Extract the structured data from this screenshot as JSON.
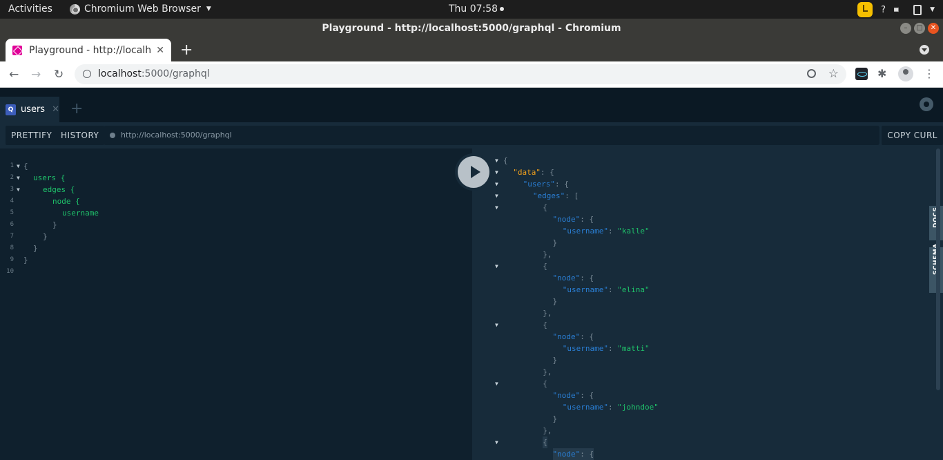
{
  "system": {
    "activities": "Activities",
    "app_name": "Chromium Web Browser",
    "clock": "Thu 07:58",
    "tray_help": "?"
  },
  "window": {
    "title": "Playground - http://localhost:5000/graphql - Chromium"
  },
  "browser": {
    "tab_title": "Playground - http://localh",
    "url_host": "localhost",
    "url_path": ":5000/graphql"
  },
  "playground": {
    "tab_icon": "Q",
    "tab_name": "users",
    "prettify": "PRETTIFY",
    "history": "HISTORY",
    "endpoint": "http://localhost:5000/graphql",
    "copy_curl": "COPY CURL",
    "docs": "DOCS",
    "schema": "SCHEMA"
  },
  "query_lines": [
    {
      "num": "1",
      "text": "{",
      "fold": true,
      "kind": "punct",
      "indent": 0
    },
    {
      "num": "2",
      "text": "users {",
      "fold": true,
      "kind": "field",
      "indent": 1
    },
    {
      "num": "3",
      "text": "edges {",
      "fold": true,
      "kind": "field",
      "indent": 2
    },
    {
      "num": "4",
      "text": "node {",
      "fold": false,
      "kind": "field",
      "indent": 3
    },
    {
      "num": "5",
      "text": "username",
      "fold": false,
      "kind": "field",
      "indent": 4
    },
    {
      "num": "6",
      "text": "}",
      "fold": false,
      "kind": "punct",
      "indent": 3
    },
    {
      "num": "7",
      "text": "}",
      "fold": false,
      "kind": "punct",
      "indent": 2
    },
    {
      "num": "8",
      "text": "}",
      "fold": false,
      "kind": "punct",
      "indent": 1
    },
    {
      "num": "9",
      "text": "}",
      "fold": false,
      "kind": "punct",
      "indent": 0
    },
    {
      "num": "10",
      "text": "",
      "fold": false,
      "kind": "punct",
      "indent": 0
    }
  ],
  "result_lines": [
    {
      "fold": true,
      "indent": 0,
      "parts": [
        [
          "p",
          "{"
        ]
      ]
    },
    {
      "fold": true,
      "indent": 1,
      "parts": [
        [
          "d",
          "\"data\""
        ],
        [
          "p",
          ": {"
        ]
      ]
    },
    {
      "fold": true,
      "indent": 2,
      "parts": [
        [
          "k",
          "\"users\""
        ],
        [
          "p",
          ": {"
        ]
      ]
    },
    {
      "fold": true,
      "indent": 3,
      "parts": [
        [
          "k",
          "\"edges\""
        ],
        [
          "p",
          ": ["
        ]
      ]
    },
    {
      "fold": true,
      "indent": 4,
      "parts": [
        [
          "p",
          "{"
        ]
      ]
    },
    {
      "fold": false,
      "indent": 5,
      "parts": [
        [
          "k",
          "\"node\""
        ],
        [
          "p",
          ": {"
        ]
      ]
    },
    {
      "fold": false,
      "indent": 6,
      "parts": [
        [
          "k",
          "\"username\""
        ],
        [
          "p",
          ": "
        ],
        [
          "s",
          "\"kalle\""
        ]
      ]
    },
    {
      "fold": false,
      "indent": 5,
      "parts": [
        [
          "p",
          "}"
        ]
      ]
    },
    {
      "fold": false,
      "indent": 4,
      "parts": [
        [
          "p",
          "},"
        ]
      ]
    },
    {
      "fold": true,
      "indent": 4,
      "parts": [
        [
          "p",
          "{"
        ]
      ]
    },
    {
      "fold": false,
      "indent": 5,
      "parts": [
        [
          "k",
          "\"node\""
        ],
        [
          "p",
          ": {"
        ]
      ]
    },
    {
      "fold": false,
      "indent": 6,
      "parts": [
        [
          "k",
          "\"username\""
        ],
        [
          "p",
          ": "
        ],
        [
          "s",
          "\"elina\""
        ]
      ]
    },
    {
      "fold": false,
      "indent": 5,
      "parts": [
        [
          "p",
          "}"
        ]
      ]
    },
    {
      "fold": false,
      "indent": 4,
      "parts": [
        [
          "p",
          "},"
        ]
      ]
    },
    {
      "fold": true,
      "indent": 4,
      "parts": [
        [
          "p",
          "{"
        ]
      ]
    },
    {
      "fold": false,
      "indent": 5,
      "parts": [
        [
          "k",
          "\"node\""
        ],
        [
          "p",
          ": {"
        ]
      ]
    },
    {
      "fold": false,
      "indent": 6,
      "parts": [
        [
          "k",
          "\"username\""
        ],
        [
          "p",
          ": "
        ],
        [
          "s",
          "\"matti\""
        ]
      ]
    },
    {
      "fold": false,
      "indent": 5,
      "parts": [
        [
          "p",
          "}"
        ]
      ]
    },
    {
      "fold": false,
      "indent": 4,
      "parts": [
        [
          "p",
          "},"
        ]
      ]
    },
    {
      "fold": true,
      "indent": 4,
      "parts": [
        [
          "p",
          "{"
        ]
      ]
    },
    {
      "fold": false,
      "indent": 5,
      "parts": [
        [
          "k",
          "\"node\""
        ],
        [
          "p",
          ": {"
        ]
      ]
    },
    {
      "fold": false,
      "indent": 6,
      "parts": [
        [
          "k",
          "\"username\""
        ],
        [
          "p",
          ": "
        ],
        [
          "s",
          "\"johndoe\""
        ]
      ]
    },
    {
      "fold": false,
      "indent": 5,
      "parts": [
        [
          "p",
          "}"
        ]
      ]
    },
    {
      "fold": false,
      "indent": 4,
      "parts": [
        [
          "p",
          "},"
        ]
      ]
    },
    {
      "fold": true,
      "indent": 4,
      "parts": [
        [
          "p",
          "{"
        ]
      ],
      "highlight": true
    },
    {
      "fold": false,
      "indent": 5,
      "parts": [
        [
          "k",
          "\"node\""
        ],
        [
          "p",
          ": {"
        ]
      ],
      "highlight": true
    }
  ],
  "colors": {
    "bg": "#0f202d",
    "panel": "#172b3a",
    "field": "#1fc16a",
    "key": "#2a7ed3",
    "data_key": "#f8a41c"
  }
}
